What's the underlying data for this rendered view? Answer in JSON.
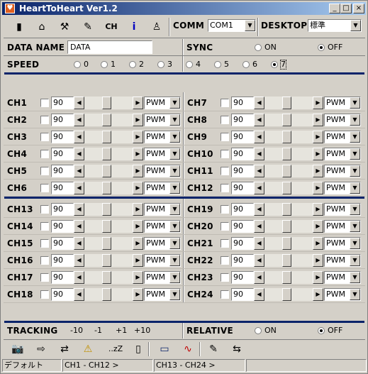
{
  "window": {
    "title": "HeartToHeart Ver1.2",
    "title_icon": "heart-icon"
  },
  "toolbar": {
    "tools": [
      {
        "name": "battery-icon",
        "glyph": "▮"
      },
      {
        "name": "home-icon",
        "glyph": "⌂"
      },
      {
        "name": "wrench-icon",
        "glyph": "⚒"
      },
      {
        "name": "script-icon",
        "glyph": "✎"
      },
      {
        "name": "ch-icon",
        "glyph": "CH"
      },
      {
        "name": "info-icon",
        "glyph": "i"
      },
      {
        "name": "figure-icon",
        "glyph": "♙"
      }
    ],
    "comm_label": "COMM",
    "comm_value": "COM1",
    "desktop_label": "DESKTOP",
    "desktop_value": "標準"
  },
  "settings": {
    "data_name_label": "DATA NAME",
    "data_name_value": "DATA",
    "sync_label": "SYNC",
    "sync_on": "ON",
    "sync_off": "OFF",
    "speed_label": "SPEED",
    "speed_options": [
      "0",
      "1",
      "2",
      "3",
      "4",
      "5",
      "6",
      "7"
    ],
    "speed_selected": "7"
  },
  "channels": [
    {
      "label": "CH1",
      "value": "90",
      "mode": "PWM"
    },
    {
      "label": "CH2",
      "value": "90",
      "mode": "PWM"
    },
    {
      "label": "CH3",
      "value": "90",
      "mode": "PWM"
    },
    {
      "label": "CH4",
      "value": "90",
      "mode": "PWM"
    },
    {
      "label": "CH5",
      "value": "90",
      "mode": "PWM"
    },
    {
      "label": "CH6",
      "value": "90",
      "mode": "PWM"
    },
    {
      "label": "CH7",
      "value": "90",
      "mode": "PWM"
    },
    {
      "label": "CH8",
      "value": "90",
      "mode": "PWM"
    },
    {
      "label": "CH9",
      "value": "90",
      "mode": "PWM"
    },
    {
      "label": "CH10",
      "value": "90",
      "mode": "PWM"
    },
    {
      "label": "CH11",
      "value": "90",
      "mode": "PWM"
    },
    {
      "label": "CH12",
      "value": "90",
      "mode": "PWM"
    },
    {
      "label": "CH13",
      "value": "90",
      "mode": "PWM"
    },
    {
      "label": "CH14",
      "value": "90",
      "mode": "PWM"
    },
    {
      "label": "CH15",
      "value": "90",
      "mode": "PWM"
    },
    {
      "label": "CH16",
      "value": "90",
      "mode": "PWM"
    },
    {
      "label": "CH17",
      "value": "90",
      "mode": "PWM"
    },
    {
      "label": "CH18",
      "value": "90",
      "mode": "PWM"
    },
    {
      "label": "CH19",
      "value": "90",
      "mode": "PWM"
    },
    {
      "label": "CH20",
      "value": "90",
      "mode": "PWM"
    },
    {
      "label": "CH21",
      "value": "90",
      "mode": "PWM"
    },
    {
      "label": "CH22",
      "value": "90",
      "mode": "PWM"
    },
    {
      "label": "CH23",
      "value": "90",
      "mode": "PWM"
    },
    {
      "label": "CH24",
      "value": "90",
      "mode": "PWM"
    }
  ],
  "tracking": {
    "label": "TRACKING",
    "buttons": [
      "-10",
      "-1",
      "+1",
      "+10"
    ],
    "relative_label": "RELATIVE",
    "on": "ON",
    "off": "OFF"
  },
  "bottom_toolbar": [
    {
      "name": "camera-icon",
      "glyph": "📷"
    },
    {
      "name": "send-icon",
      "glyph": "⇨"
    },
    {
      "name": "sync-icon",
      "glyph": "⇄"
    },
    {
      "name": "warning-icon",
      "glyph": "⚠"
    },
    {
      "name": "sleep-icon",
      "glyph": "..zZ"
    },
    {
      "name": "mouse-icon",
      "glyph": "▯"
    },
    {
      "name": "window-icon",
      "glyph": "▭"
    },
    {
      "name": "graph-icon",
      "glyph": "∿"
    },
    {
      "name": "edit-icon",
      "glyph": "✎"
    },
    {
      "name": "transfer-icon",
      "glyph": "⇆"
    }
  ],
  "status_bar": [
    "デフォルト",
    "CH1 - CH12 >",
    "CH13 - CH24 >",
    ""
  ]
}
